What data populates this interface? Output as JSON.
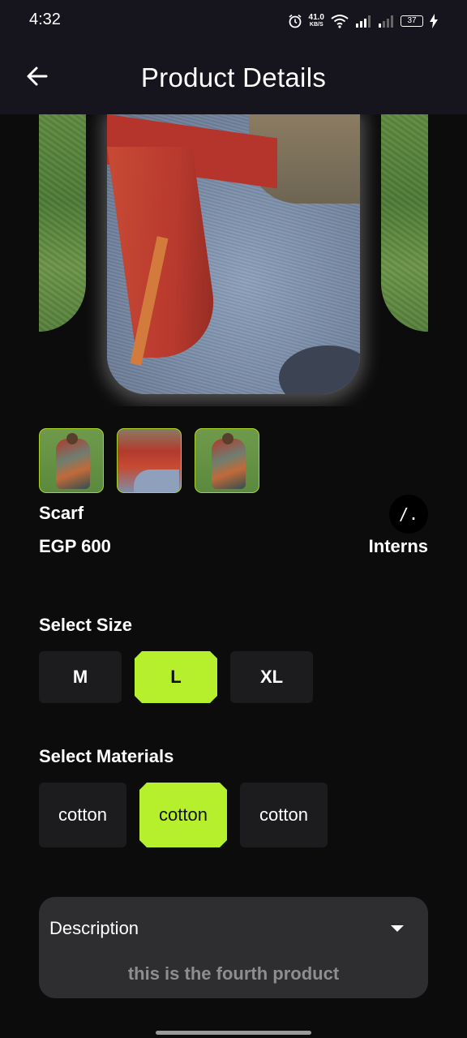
{
  "status_bar": {
    "time": "4:32",
    "net_speed_value": "41.0",
    "net_speed_unit": "KB/S",
    "battery": "37"
  },
  "app_bar": {
    "title": "Product Details"
  },
  "product": {
    "name": "Scarf",
    "price": "EGP 600",
    "brand_logo_text": "/.",
    "brand_name": "Interns"
  },
  "sizes": {
    "title": "Select Size",
    "options": [
      "M",
      "L",
      "XL"
    ],
    "selected": "L"
  },
  "materials": {
    "title": "Select Materials",
    "options": [
      "cotton",
      "cotton",
      "cotton"
    ],
    "selected_index": 1
  },
  "description": {
    "label": "Description",
    "text": "this is the fourth product"
  },
  "colors": {
    "accent": "#b6ef2b",
    "background": "#0c0c0d",
    "app_bar": "#16141c",
    "card": "#2e2e30",
    "chip": "#1c1c1f"
  }
}
